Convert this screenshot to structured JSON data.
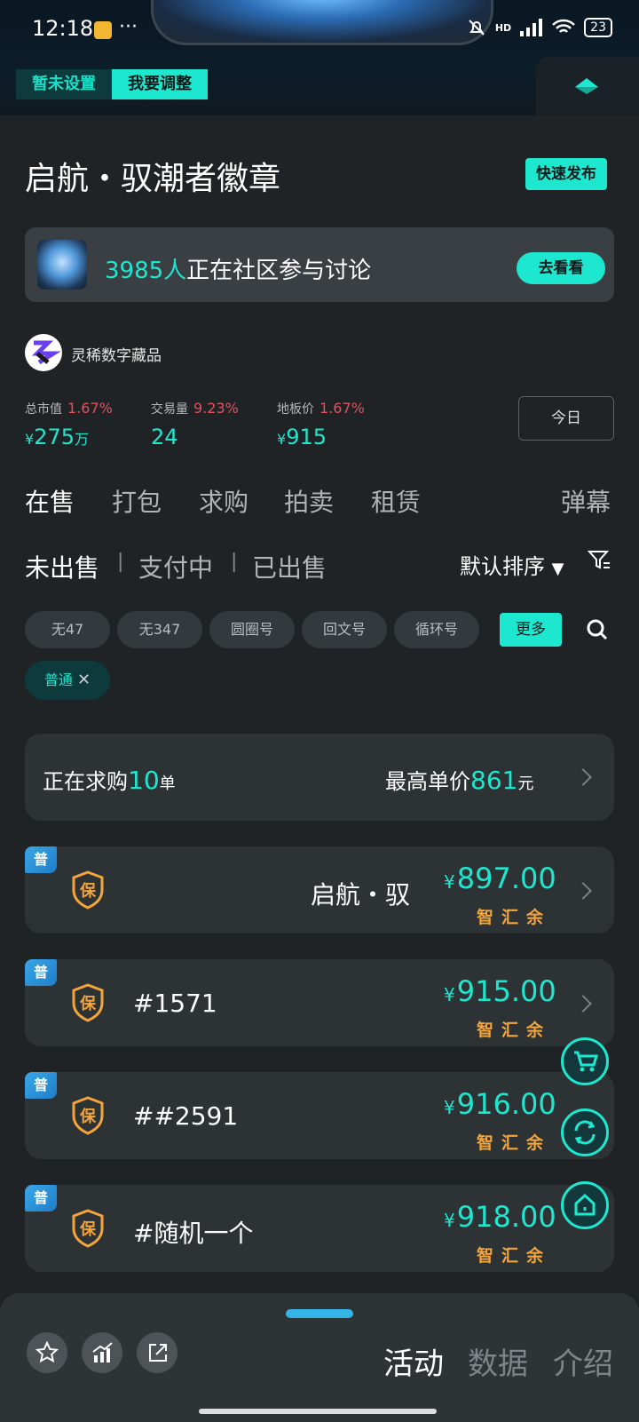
{
  "status_bar": {
    "time": "12:18",
    "more": "···",
    "network": "HD",
    "battery": "23"
  },
  "top_segment": {
    "left": "暂未设置",
    "right": "我要调整"
  },
  "header": {
    "title": "启航・驭潮者徽章",
    "quick_publish": "快速发布"
  },
  "community": {
    "count": "3985人",
    "text": "正在社区参与讨论",
    "button": "去看看"
  },
  "publisher": {
    "name": "灵稀数字藏品"
  },
  "stats": [
    {
      "label": "总市值",
      "change": "1.67%",
      "prefix": "¥",
      "value": "275",
      "unit": "万"
    },
    {
      "label": "交易量",
      "change": "9.23%",
      "prefix": "",
      "value": "24",
      "unit": ""
    },
    {
      "label": "地板价",
      "change": "1.67%",
      "prefix": "¥",
      "value": "915",
      "unit": ""
    }
  ],
  "today_button": "今日",
  "main_tabs": [
    "在售",
    "打包",
    "求购",
    "拍卖",
    "租赁"
  ],
  "danmaku": "弹幕",
  "sub_tabs": [
    "未出售",
    "支付中",
    "已出售"
  ],
  "sort_label": "默认排序",
  "chips": [
    "无47",
    "无347",
    "圆圈号",
    "回文号",
    "循环号"
  ],
  "more_chip": "更多",
  "active_tag": "普通",
  "request": {
    "prefix": "正在求购",
    "count": "10",
    "unit": "单",
    "price_label": "最高单价",
    "price": "861",
    "price_unit": "元"
  },
  "listings": [
    {
      "badge": "普",
      "shield": "保",
      "name": "启航・驭",
      "price": "897.00",
      "pay": "智汇余"
    },
    {
      "badge": "普",
      "shield": "保",
      "name": "#1571",
      "price": "915.00",
      "pay": "智汇余"
    },
    {
      "badge": "普",
      "shield": "保",
      "name": "##2591",
      "price": "916.00",
      "pay": "智汇余"
    },
    {
      "badge": "普",
      "shield": "保",
      "name": "#随机一个",
      "price": "918.00",
      "pay": "智汇余"
    }
  ],
  "currency": "¥",
  "bottom_tabs": [
    "活动",
    "数据",
    "介绍"
  ],
  "colors": {
    "accent": "#1ee7cf",
    "warning": "#f3a53a",
    "down": "#e2525e",
    "background": "#1f2325"
  }
}
